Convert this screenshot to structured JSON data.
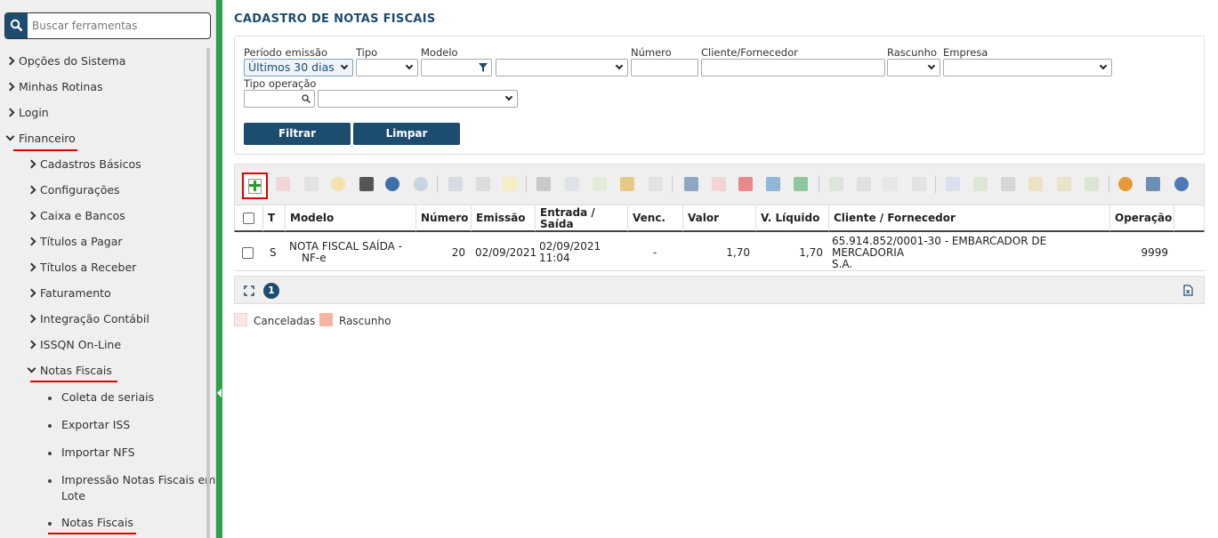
{
  "sidebar": {
    "search_placeholder": "Buscar ferramentas",
    "items": [
      {
        "label": "Opções do Sistema"
      },
      {
        "label": "Minhas Rotinas"
      },
      {
        "label": "Login"
      },
      {
        "label": "Financeiro"
      },
      {
        "label": "Cadastros Básicos"
      },
      {
        "label": "Configurações"
      },
      {
        "label": "Caixa e Bancos"
      },
      {
        "label": "Títulos a Pagar"
      },
      {
        "label": "Títulos a Receber"
      },
      {
        "label": "Faturamento"
      },
      {
        "label": "Integração Contábil"
      },
      {
        "label": "ISSQN On-Line"
      },
      {
        "label": "Notas Fiscais"
      },
      {
        "label": "Coleta de seriais"
      },
      {
        "label": "Exportar ISS"
      },
      {
        "label": "Importar NFS"
      },
      {
        "label": "Impressão Notas Fiscais em",
        "label2": "Lote"
      },
      {
        "label": "Notas Fiscais"
      }
    ]
  },
  "page": {
    "title": "CADASTRO DE NOTAS FISCAIS"
  },
  "filters": {
    "periodo_label": "Período emissão",
    "periodo_value": "Últimos 30 dias",
    "tipo_label": "Tipo",
    "modelo_label": "Modelo",
    "numero_label": "Número",
    "cliente_label": "Cliente/Fornecedor",
    "rascunho_label": "Rascunho",
    "empresa_label": "Empresa",
    "tipo_operacao_label": "Tipo operação",
    "filtrar_label": "Filtrar",
    "limpar_label": "Limpar"
  },
  "grid": {
    "columns": [
      "T",
      "Modelo",
      "Número",
      "Emissão",
      "Entrada / Saída",
      "Venc.",
      "Valor",
      "V. Líquido",
      "Cliente / Fornecedor",
      "Operação"
    ],
    "col_entrada_1": "Entrada /",
    "col_entrada_2": "Saída",
    "rows": [
      {
        "tipo": "S",
        "modelo_1": "NOTA FISCAL SAÍDA -",
        "modelo_2": "NF-e",
        "numero": "20",
        "emissao": "02/09/2021",
        "entrada_1": "02/09/2021",
        "entrada_2": "11:04",
        "venc": "-",
        "valor": "1,70",
        "v_liquido": "1,70",
        "cliente_1": "65.914.852/0001-30 - EMBARCADOR DE MERCADORIA",
        "cliente_2": "S.A.",
        "operacao": "9999"
      }
    ]
  },
  "pager": {
    "current_page": "1"
  },
  "legend": [
    {
      "label": "Canceladas",
      "color": "#fbe6e6"
    },
    {
      "label": "Rascunho",
      "color": "#f9b4a0"
    }
  ],
  "colors": {
    "brand": "#1c4d6f",
    "accent_bar": "#2aa24a",
    "highlight": "#d00000"
  }
}
